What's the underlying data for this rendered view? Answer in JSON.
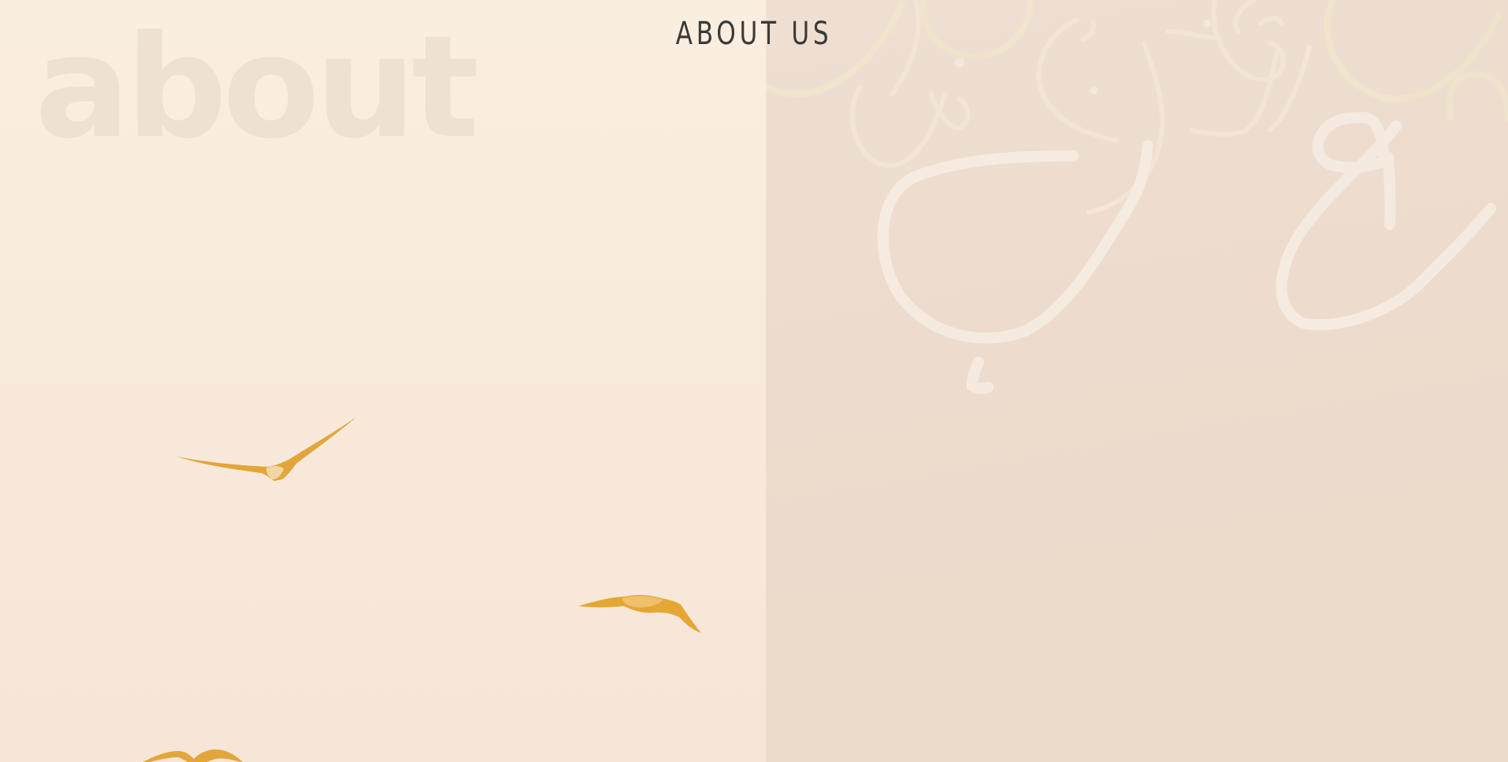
{
  "hero": {
    "watermark": "about",
    "title": "ABOUT US"
  },
  "icons": {
    "birds": [
      "seagull-icon",
      "seagull-icon",
      "seagull-icon"
    ],
    "calligraphy": "arabic-calligraphy-icon"
  },
  "colors": {
    "left_background": "#faeee1",
    "right_background": "#eddccd",
    "bird_color": "#e3a838",
    "title_color": "#3b3a38",
    "calligraphy_color": "#f5e9de"
  }
}
